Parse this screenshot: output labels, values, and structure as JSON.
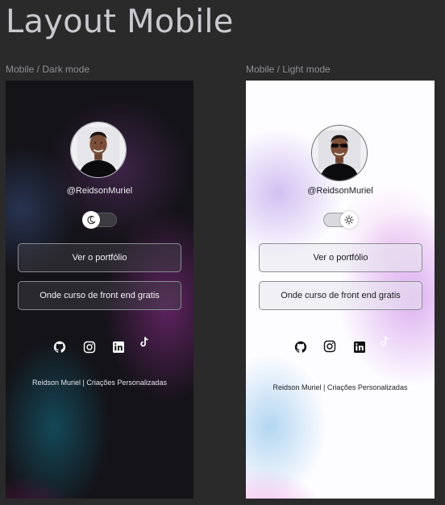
{
  "page": {
    "title": "Layout Mobile"
  },
  "frames": {
    "dark": {
      "label": "Mobile / Dark mode",
      "username": "@ReidsonMuriel",
      "theme_toggle": {
        "state": "dark",
        "icon": "moon-icon"
      },
      "buttons": [
        {
          "label": "Ver o portfólio"
        },
        {
          "label": "Onde curso de front end gratis"
        }
      ],
      "social_icons": [
        "github-icon",
        "instagram-icon",
        "linkedin-icon",
        "tiktok-icon"
      ],
      "footer": "Reidson Muriel | Criações Personalizadas",
      "colors": {
        "background": "#141318",
        "text": "#ececf0",
        "accent": "#96146e"
      }
    },
    "light": {
      "label": "Mobile / Light mode",
      "username": "@ReidsonMuriel",
      "theme_toggle": {
        "state": "light",
        "icon": "sun-icon"
      },
      "buttons": [
        {
          "label": "Ver o portfólio"
        },
        {
          "label": "Onde curso de front end gratis"
        }
      ],
      "social_icons": [
        "github-icon",
        "instagram-icon",
        "linkedin-icon",
        "tiktok-icon"
      ],
      "footer": "Reidson Muriel | Criações Personalizadas",
      "colors": {
        "background": "#fdfcff",
        "text": "#1c1c22",
        "accent": "#eb82dc"
      }
    }
  }
}
